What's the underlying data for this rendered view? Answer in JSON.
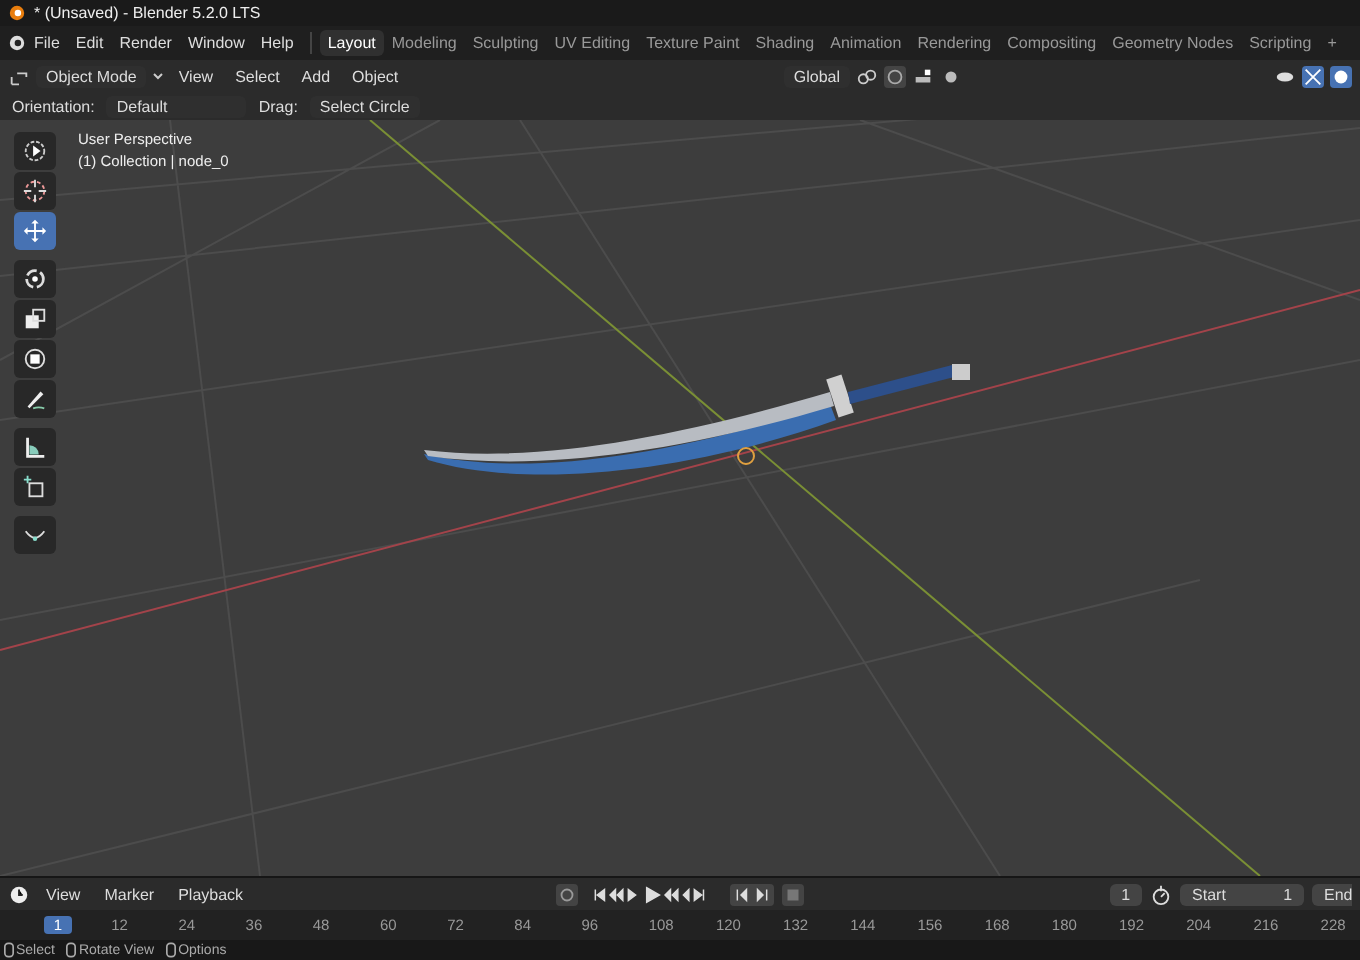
{
  "window": {
    "title": "* (Unsaved) - Blender 5.2.0 LTS"
  },
  "menu_bar": {
    "items": [
      "File",
      "Edit",
      "Render",
      "Window",
      "Help"
    ]
  },
  "workspaces": [
    {
      "label": "Layout",
      "selected": true
    },
    {
      "label": "Modeling",
      "selected": false
    },
    {
      "label": "Sculpting",
      "selected": false
    },
    {
      "label": "UV Editing",
      "selected": false
    },
    {
      "label": "Texture Paint",
      "selected": false
    },
    {
      "label": "Shading",
      "selected": false
    },
    {
      "label": "Animation",
      "selected": false
    },
    {
      "label": "Rendering",
      "selected": false
    },
    {
      "label": "Compositing",
      "selected": false
    },
    {
      "label": "Geometry Nodes",
      "selected": false
    },
    {
      "label": "Scripting",
      "selected": false
    }
  ],
  "add_workspace": "+",
  "header": {
    "mode": "Object Mode",
    "menus": [
      "View",
      "Select",
      "Add",
      "Object"
    ],
    "transform": "Global"
  },
  "tool_settings": {
    "orientation_label": "Orientation:",
    "orientation": "Default",
    "drag_label": "Drag:",
    "drag": "Select Circle"
  },
  "viewport": {
    "info": [
      "User Perspective",
      "(1) Collection | node_0"
    ],
    "tools": [
      {
        "kind": "select",
        "selected": false
      },
      {
        "kind": "cursor",
        "selected": false
      },
      {
        "kind": "move",
        "selected": true
      },
      {
        "kind": "rotate",
        "selected": false
      },
      {
        "kind": "scale",
        "selected": false
      },
      {
        "kind": "transform",
        "selected": false
      },
      {
        "kind": "annotate",
        "selected": false
      },
      {
        "kind": "measure",
        "selected": false
      },
      {
        "kind": "addcube",
        "selected": false
      },
      {
        "kind": "curve",
        "selected": false
      }
    ]
  },
  "timeline": {
    "menus": [
      "View",
      "Marker",
      "Playback"
    ],
    "current_frame": "1",
    "start_label": "Start",
    "start": "1",
    "end_label": "End",
    "ticks": [
      {
        "label": "1",
        "selected": true
      },
      {
        "label": "12",
        "selected": false
      },
      {
        "label": "24",
        "selected": false
      },
      {
        "label": "36",
        "selected": false
      },
      {
        "label": "48",
        "selected": false
      },
      {
        "label": "60",
        "selected": false
      },
      {
        "label": "72",
        "selected": false
      },
      {
        "label": "84",
        "selected": false
      },
      {
        "label": "96",
        "selected": false
      },
      {
        "label": "108",
        "selected": false
      },
      {
        "label": "120",
        "selected": false
      },
      {
        "label": "132",
        "selected": false
      },
      {
        "label": "144",
        "selected": false
      },
      {
        "label": "156",
        "selected": false
      },
      {
        "label": "168",
        "selected": false
      },
      {
        "label": "180",
        "selected": false
      },
      {
        "label": "192",
        "selected": false
      },
      {
        "label": "204",
        "selected": false
      },
      {
        "label": "216",
        "selected": false
      },
      {
        "label": "228",
        "selected": false
      }
    ]
  },
  "status_bar": [
    "Select",
    "Rotate View",
    "Options"
  ]
}
